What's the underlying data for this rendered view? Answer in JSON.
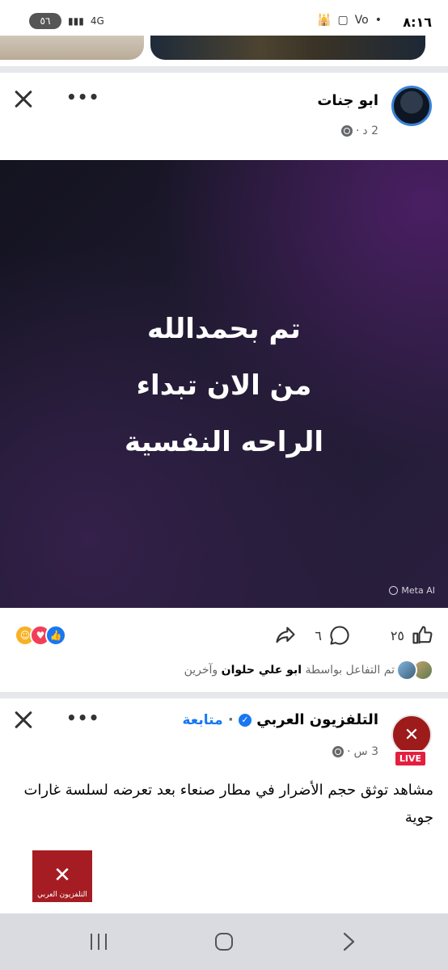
{
  "status_bar": {
    "time": "٨:١٦",
    "battery": "٥٦",
    "network": "4G",
    "network_sub": "Vo"
  },
  "post1": {
    "author": "ابو جنات",
    "time": "2 د",
    "image_lines": [
      "تم بحمدالله",
      "من الان تبداء",
      "الراحه النفسية"
    ],
    "watermark": "Meta AI",
    "likes_count": "٢٥",
    "comments_count": "٦",
    "liked_by_prefix": "تم التفاعل بواسطة",
    "liked_by_name": "ابو علي حلوان",
    "liked_by_suffix": "وآخرين",
    "reactions": [
      "like-icon",
      "love-icon",
      "haha-icon"
    ]
  },
  "post2": {
    "author": "التلفزيون العربي",
    "follow_label": "متابعة",
    "time": "3 س",
    "live_badge": "LIVE",
    "text": "مشاهد توثق حجم الأضرار في مطار صنعاء بعد تعرضه لسلسة غارات جوية",
    "thumb_caption": "التلفزيون العربي"
  },
  "colors": {
    "facebook_blue": "#1877f2",
    "live_red": "#e41e3f",
    "separator": "#e6e8eb",
    "brand_red": "#a51d23"
  }
}
